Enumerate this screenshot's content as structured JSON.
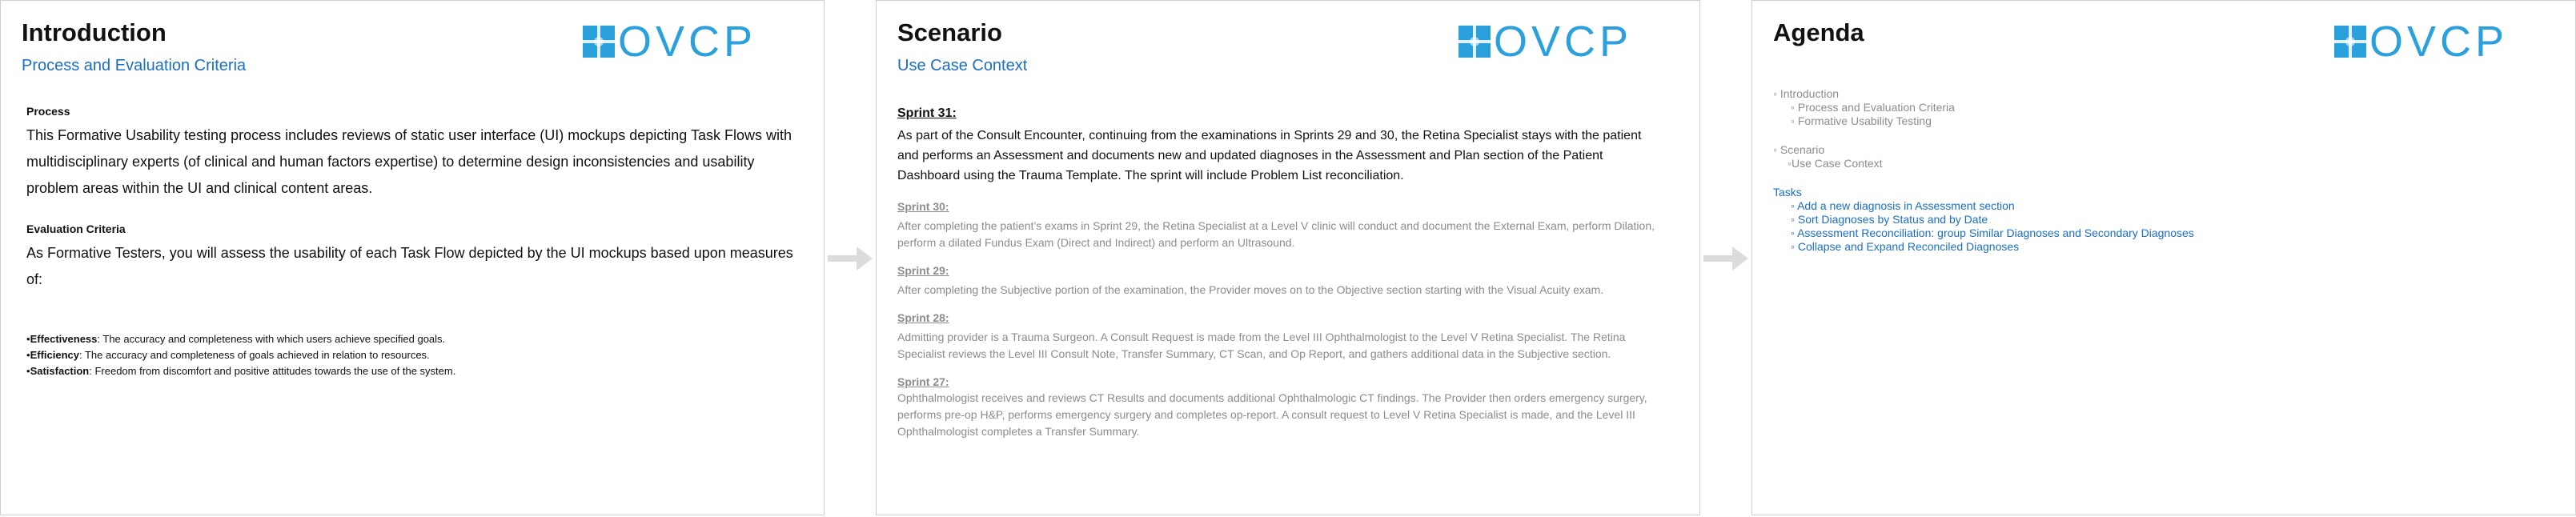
{
  "logo_text": "OVCP",
  "colors": {
    "accent_blue": "#1a6fc4",
    "logo_blue": "#2aa0dc",
    "muted_gray": "#8c8c8c"
  },
  "slide1": {
    "title": "Introduction",
    "subtitle": "Process and Evaluation Criteria",
    "process_heading": "Process",
    "process_text": "This Formative Usability testing process includes reviews of static user interface (UI) mockups depicting Task Flows with multidisciplinary experts (of clinical and human factors expertise) to determine design inconsistencies and usability problem areas within the UI and clinical content areas.",
    "eval_heading": "Evaluation Criteria",
    "eval_text": "As Formative Testers, you will assess the usability of each Task Flow depicted by the UI mockups based upon measures of:",
    "criteria": [
      {
        "term": "Effectiveness",
        "desc": ": The accuracy and completeness with which users achieve specified goals."
      },
      {
        "term": "Efficiency",
        "desc": ": The accuracy and completeness of goals achieved in relation to resources."
      },
      {
        "term": "Satisfaction",
        "desc": ": Freedom from discomfort and positive attitudes towards the use of the system."
      }
    ]
  },
  "slide2": {
    "title": "Scenario",
    "subtitle": "Use Case Context",
    "sprint31_heading": "Sprint 31:",
    "sprint31_text": "As part of the Consult Encounter, continuing from the examinations in Sprints 29 and 30, the Retina Specialist stays with the patient and performs an Assessment and documents new and updated diagnoses in the Assessment and Plan section of the Patient Dashboard using the Trauma Template. The sprint will include Problem List reconciliation.",
    "sprint30_heading": "Sprint 30:",
    "sprint30_text": "After completing the patient’s exams in Sprint 29,  the Retina Specialist at a Level V clinic will conduct and document the External Exam, perform Dilation, perform a dilated Fundus Exam (Direct and Indirect)  and perform an Ultrasound.",
    "sprint29_heading": "Sprint 29:",
    "sprint29_text": "After completing the Subjective portion of the examination, the Provider moves on to the Objective section starting with the Visual Acuity exam.",
    "sprint28_heading": "Sprint 28:",
    "sprint28_text": "Admitting provider is a Trauma Surgeon. A Consult Request is made from the Level III Ophthalmologist to the Level V Retina Specialist. The Retina Specialist reviews the Level III Consult Note, Transfer Summary, CT Scan, and Op Report, and gathers additional data in the Subjective section.",
    "sprint27_heading": "Sprint 27:",
    "sprint27_text": "Ophthalmologist receives and reviews CT Results and documents additional Ophthalmologic CT findings. The Provider then orders emergency surgery, performs pre-op H&P, performs emergency surgery and completes op-report.  A consult request to Level V Retina Specialist is made, and the Level III Ophthalmologist completes a Transfer Summary."
  },
  "slide3": {
    "title": "Agenda",
    "intro": "◦ Introduction",
    "intro_subs": [
      "◦ Process and Evaluation Criteria",
      "◦ Formative Usability Testing"
    ],
    "scenario": "◦ Scenario",
    "scenario_sub": "◦Use Case Context",
    "tasks": "Tasks",
    "task_items": [
      "◦ Add a new diagnosis in Assessment section",
      "◦ Sort Diagnoses by Status and by Date",
      "◦ Assessment Reconciliation: group Similar Diagnoses and Secondary Diagnoses",
      "◦ Collapse and Expand Reconciled Diagnoses"
    ]
  }
}
